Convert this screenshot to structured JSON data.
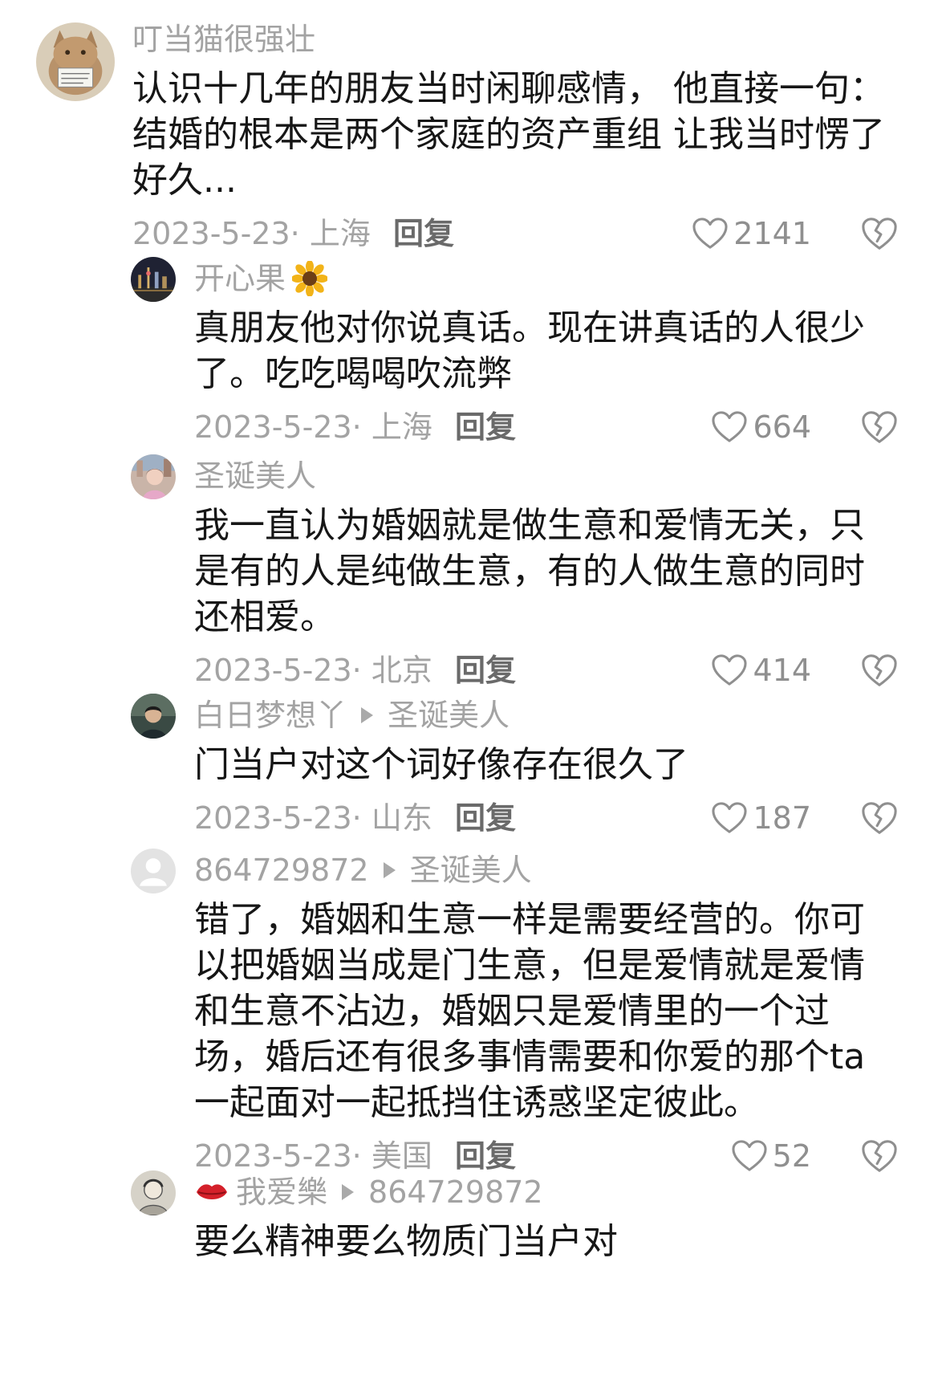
{
  "comments": [
    {
      "username": "叮当猫很强壮",
      "reply_to": "",
      "text": "认识十几年的朋友当时闲聊感情， 他直接一句：结婚的根本是两个家庭的资产重组 让我当时愣了好久...",
      "date_location": "2023-5-23· 上海",
      "reply_label": "回复",
      "likes": "2141",
      "avatar_icon": "cat-avatar"
    },
    {
      "username": "开心果",
      "reply_to": "",
      "text": "真朋友他对你说真话。现在讲真话的人很少了。吃吃喝喝吹流弊",
      "date_location": "2023-5-23· 上海",
      "reply_label": "回复",
      "likes": "664",
      "avatar_icon": "city-night-avatar",
      "name_emoji": "sunflower-icon"
    },
    {
      "username": "圣诞美人",
      "reply_to": "",
      "text": "我一直认为婚姻就是做生意和爱情无关，只是有的人是纯做生意，有的人做生意的同时还相爱。",
      "date_location": "2023-5-23· 北京",
      "reply_label": "回复",
      "likes": "414",
      "avatar_icon": "portrait-avatar"
    },
    {
      "username": "白日梦想丫",
      "reply_to": "圣诞美人",
      "text": "门当户对这个词好像存在很久了",
      "date_location": "2023-5-23· 山东",
      "reply_label": "回复",
      "likes": "187",
      "avatar_icon": "man-avatar"
    },
    {
      "username": "864729872",
      "reply_to": "圣诞美人",
      "text": "错了，婚姻和生意一样是需要经营的。你可以把婚姻当成是门生意，但是爱情就是爱情和生意不沾边，婚姻只是爱情里的一个过场，婚后还有很多事情需要和你爱的那个ta一起面对一起抵挡住诱惑坚定彼此。",
      "date_location": "2023-5-23· 美国",
      "reply_label": "回复",
      "likes": "52",
      "avatar_icon": "default-user-avatar"
    },
    {
      "username": "我爱樂",
      "reply_to": "864729872",
      "text": "要么精神要么物质门当户对",
      "date_location": "",
      "reply_label": "",
      "likes": "",
      "avatar_icon": "sketch-avatar",
      "name_prefix_emoji": "lips-icon"
    }
  ],
  "colors": {
    "text": "#161616",
    "secondary": "#a3a3a3",
    "reply": "#6a6a6a",
    "icon": "#8f8f8f"
  }
}
